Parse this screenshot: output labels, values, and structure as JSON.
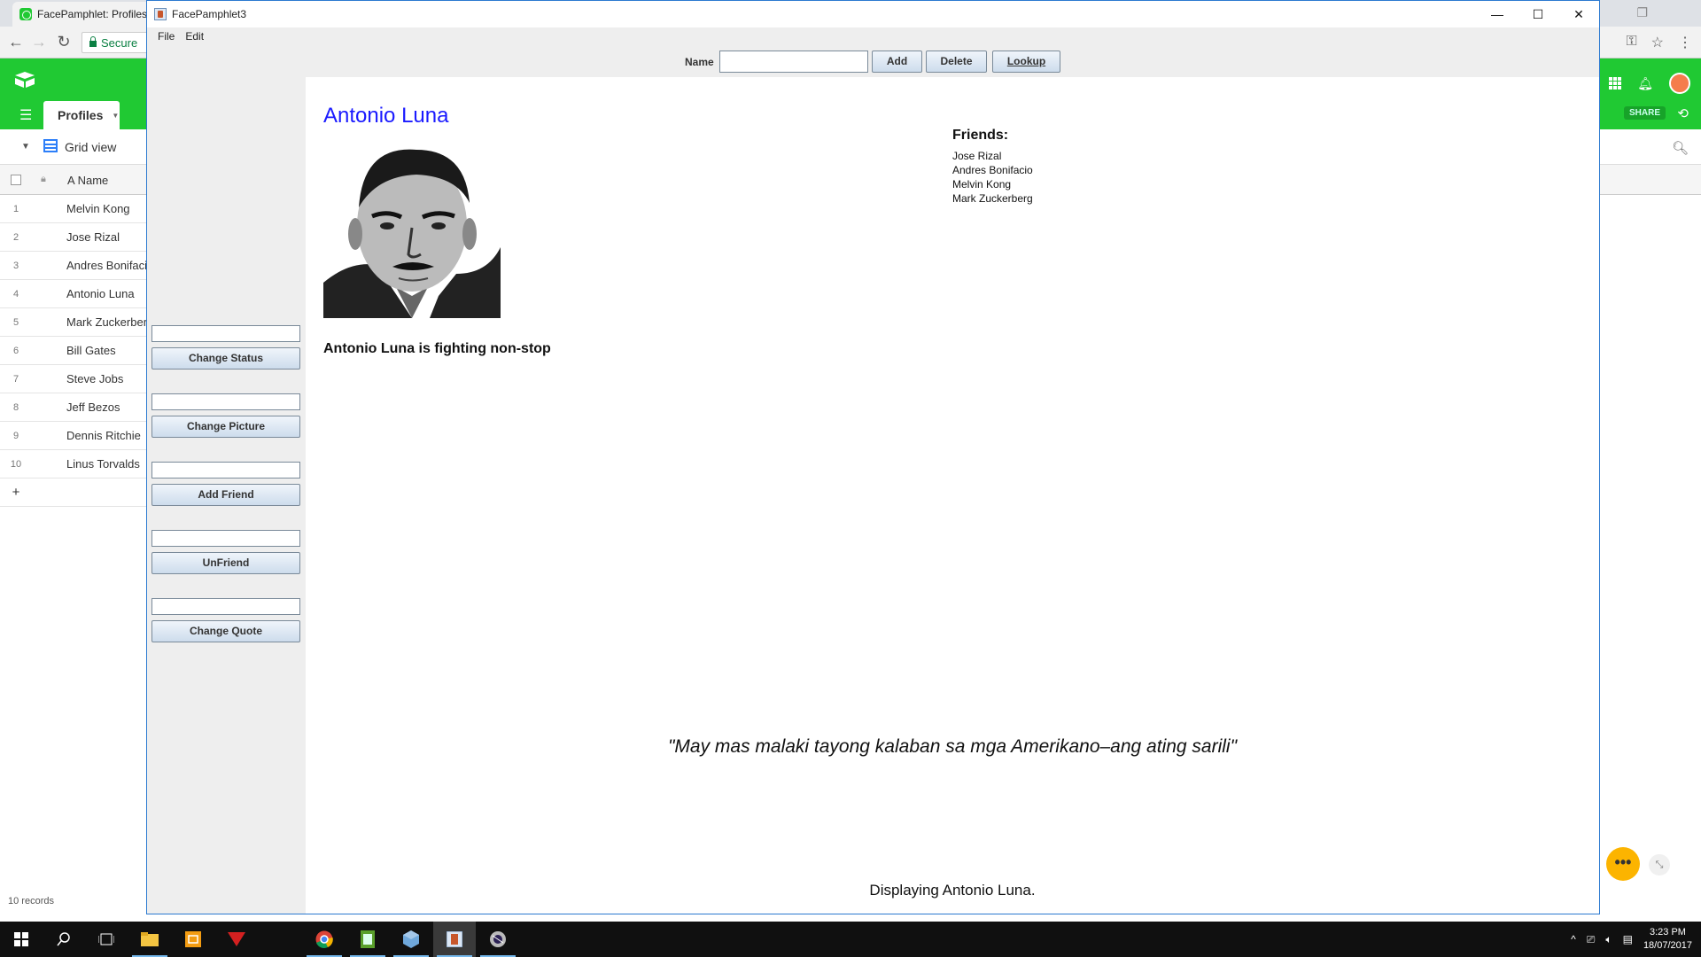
{
  "browser": {
    "tab_title": "FacePamphlet: Profiles",
    "address_text": "Secure",
    "restore_glyph": "❐"
  },
  "airtable": {
    "tab_label": "Profiles",
    "view_label": "Grid view",
    "share_label": "SHARE",
    "column_name": "Name",
    "rows": [
      {
        "num": "1",
        "name": "Melvin Kong"
      },
      {
        "num": "2",
        "name": "Jose Rizal"
      },
      {
        "num": "3",
        "name": "Andres Bonifacio"
      },
      {
        "num": "4",
        "name": "Antonio Luna"
      },
      {
        "num": "5",
        "name": "Mark Zuckerberg"
      },
      {
        "num": "6",
        "name": "Bill Gates"
      },
      {
        "num": "7",
        "name": "Steve Jobs"
      },
      {
        "num": "8",
        "name": "Jeff Bezos"
      },
      {
        "num": "9",
        "name": "Dennis Ritchie"
      },
      {
        "num": "10",
        "name": "Linus Torvalds"
      }
    ],
    "add_row": "+",
    "records_count": "10 records",
    "fab_label": "•••",
    "accent": "#20c933"
  },
  "app": {
    "window_title": "FacePamphlet3",
    "menu": [
      "File",
      "Edit"
    ],
    "name_label": "Name",
    "name_value": "",
    "add_label": "Add",
    "delete_label": "Delete",
    "lookup_label": "Lookup",
    "side_actions": [
      {
        "field_value": "",
        "label": "Change Status"
      },
      {
        "field_value": "",
        "label": "Change Picture"
      },
      {
        "field_value": "",
        "label": "Add Friend"
      },
      {
        "field_value": "",
        "label": "UnFriend"
      },
      {
        "field_value": "",
        "label": "Change Quote"
      }
    ],
    "profile": {
      "name": "Antonio Luna",
      "status": "Antonio Luna is fighting non-stop",
      "friends_heading": "Friends:",
      "friends": [
        "Jose Rizal",
        "Andres Bonifacio",
        "Melvin Kong",
        "Mark Zuckerberg"
      ],
      "quote": "\"May mas malaki tayong kalaban sa mga Amerikano–ang ating sarili\"",
      "name_color": "#1a1aff"
    },
    "message": "Displaying Antonio Luna."
  },
  "taskbar": {
    "time": "3:23 PM",
    "date": "18/07/2017"
  }
}
